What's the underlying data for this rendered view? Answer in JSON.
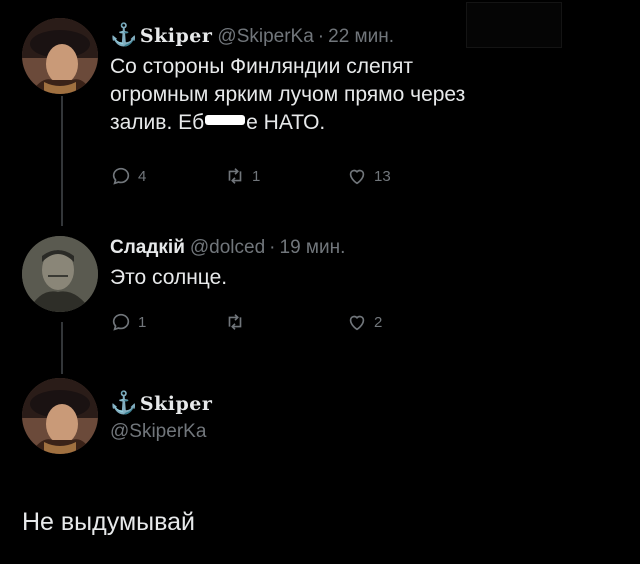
{
  "tweets": [
    {
      "name": "Skiper",
      "handle": "@SkiperKa",
      "separator": "·",
      "time": "22 мин.",
      "text_before": "Со стороны Финляндии слепят\nогромным ярким лучом прямо через\nзалив. Еб",
      "text_after": "е НАТО.",
      "actions": {
        "reply_count": "4",
        "retweet_count": "1",
        "like_count": "13"
      }
    },
    {
      "name": "Сладкій",
      "handle": "@dolced",
      "separator": "·",
      "time": "19 мин.",
      "text": "Это солнце.",
      "actions": {
        "reply_count": "1",
        "retweet_count": "",
        "like_count": "2"
      }
    }
  ],
  "main_tweet": {
    "name": "Skiper",
    "handle": "@SkiperKa",
    "text": "Не выдумывай"
  },
  "icons": {
    "reply": "reply-icon",
    "retweet": "retweet-icon",
    "like": "like-icon",
    "name_prefix": "anchor-icon"
  }
}
